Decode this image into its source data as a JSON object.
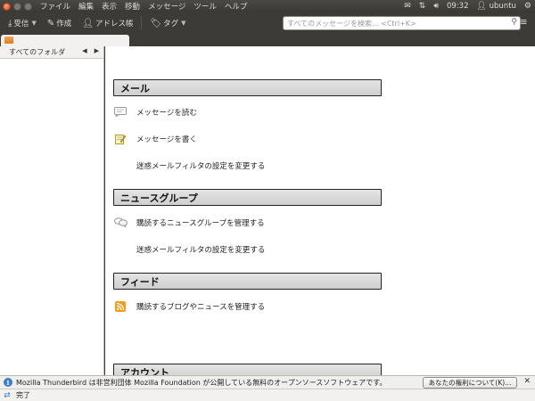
{
  "panel": {
    "menu": [
      "ファイル",
      "編集",
      "表示",
      "移動",
      "メッセージ",
      "ツール",
      "ヘルプ"
    ],
    "time": "09:32",
    "user": "ubuntu",
    "icons": [
      "mail-icon",
      "network-icon",
      "volume-icon",
      "user-icon",
      "gear-icon"
    ]
  },
  "toolbar": {
    "receive": "受信",
    "compose": "作成",
    "address_book": "アドレス帳",
    "tag": "タグ",
    "search_placeholder": "すべてのメッセージを検索... <Ctrl+K>"
  },
  "folder_pane": {
    "header": "すべてのフォルダ"
  },
  "sections": [
    {
      "title": "メール",
      "links": [
        {
          "label": "メッセージを読む",
          "icon": "read-mail-icon"
        },
        {
          "label": "メッセージを書く",
          "icon": "compose-icon"
        },
        {
          "label": "迷惑メールフィルタの設定を変更する",
          "icon": ""
        }
      ]
    },
    {
      "title": "ニュースグループ",
      "links": [
        {
          "label": "購読するニュースグループを管理する",
          "icon": "newsgroup-icon"
        },
        {
          "label": "迷惑メールフィルタの設定を変更する",
          "icon": ""
        }
      ]
    },
    {
      "title": "フィード",
      "links": [
        {
          "label": "購読するブログやニュースを管理する",
          "icon": "rss-icon"
        }
      ]
    },
    {
      "title": "アカウント",
      "links": []
    }
  ],
  "notification": {
    "text": "Mozilla Thunderbird は非営利団体 Mozilla Foundation が公開している無料のオープンソースソフトウェアです。",
    "button": "あなたの権利について(K)..."
  },
  "status": {
    "text": "完了"
  },
  "colors": {
    "panel_bg": "#3c3b37",
    "close_button": "#e0471c",
    "info_icon": "#3a7fc8",
    "rss_orange": "#f39c1f"
  }
}
